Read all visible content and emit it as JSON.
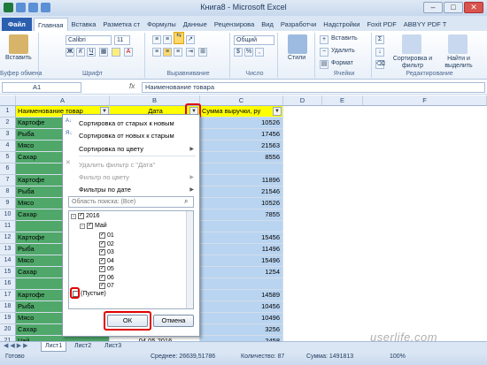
{
  "window": {
    "title": "Книга8 - Microsoft Excel"
  },
  "tabs": [
    "Файл",
    "Главная",
    "Вставка",
    "Разметка ст",
    "Формулы",
    "Данные",
    "Рецензирова",
    "Вид",
    "Разработчи",
    "Надстройки",
    "Foxit PDF",
    "ABBYY PDF T"
  ],
  "ribbon": {
    "paste": "Вставить",
    "clipboard": "Буфер обмена",
    "font_name": "Calibri",
    "font_size": "11",
    "font_group": "Шрифт",
    "align_group": "Выравнивание",
    "number_format": "Общий",
    "number_group": "Число",
    "styles": "Стили",
    "insert": "Вставить",
    "delete": "Удалить",
    "format": "Формат",
    "cells_group": "Ячейки",
    "sort": "Сортировка и фильтр",
    "find": "Найти и выделить",
    "edit_group": "Редактирование"
  },
  "formula_bar": {
    "name_box": "A1",
    "fx": "fx",
    "content": "Наименование товара"
  },
  "columns": [
    "A",
    "B",
    "C",
    "D",
    "E",
    "F"
  ],
  "headers": {
    "a": "Наименование товар",
    "b": "Дата",
    "c": "Сумма выручки, ру"
  },
  "rows": [
    {
      "n": "1"
    },
    {
      "n": "2",
      "a": "Картофе",
      "c": "10526"
    },
    {
      "n": "3",
      "a": "Рыба",
      "c": "17456"
    },
    {
      "n": "4",
      "a": "Мясо",
      "c": "21563"
    },
    {
      "n": "5",
      "a": "Сахар",
      "c": "8556"
    },
    {
      "n": "6",
      "a": "",
      "c": ""
    },
    {
      "n": "7",
      "a": "Картофе",
      "c": "11896"
    },
    {
      "n": "8",
      "a": "Рыба",
      "c": "21546"
    },
    {
      "n": "9",
      "a": "Мясо",
      "c": "10526"
    },
    {
      "n": "10",
      "a": "Сахар",
      "c": "7855"
    },
    {
      "n": "11",
      "a": "",
      "c": ""
    },
    {
      "n": "12",
      "a": "Картофе",
      "c": "15456"
    },
    {
      "n": "13",
      "a": "Рыба",
      "c": "11496"
    },
    {
      "n": "14",
      "a": "Мясо",
      "c": "15496"
    },
    {
      "n": "15",
      "a": "Сахар",
      "c": "1254"
    },
    {
      "n": "16",
      "a": "",
      "c": ""
    },
    {
      "n": "17",
      "a": "Картофе",
      "c": "14589"
    },
    {
      "n": "18",
      "a": "Рыба",
      "c": "10456"
    },
    {
      "n": "19",
      "a": "Мясо",
      "c": "10496"
    },
    {
      "n": "20",
      "a": "Сахар",
      "c": "3256"
    },
    {
      "n": "21",
      "a": "Чай",
      "b": "04.05.2016",
      "c": "2458"
    }
  ],
  "filter_menu": {
    "sort_old_new": "Сортировка от старых к новым",
    "sort_new_old": "Сортировка от новых к старым",
    "sort_color": "Сортировка по цвету",
    "remove_filter": "Удалить фильтр с \"Дата\"",
    "filter_color": "Фильтр по цвету",
    "date_filters": "Фильтры по дате",
    "search_placeholder": "Область поиска: (Все)",
    "tree": {
      "year": "2016",
      "month": "Май",
      "days": [
        "01",
        "02",
        "03",
        "04",
        "05",
        "06",
        "07"
      ],
      "blanks": "(Пустые)"
    },
    "ok": "ОК",
    "cancel": "Отмена"
  },
  "sheets": [
    "Лист1",
    "Лист2",
    "Лист3"
  ],
  "status": {
    "ready": "Готово",
    "average": "Среднее: 26639,51786",
    "count": "Количество: 87",
    "sum": "Сумма: 1491813",
    "zoom": "100%"
  },
  "watermark": "userlife.com"
}
